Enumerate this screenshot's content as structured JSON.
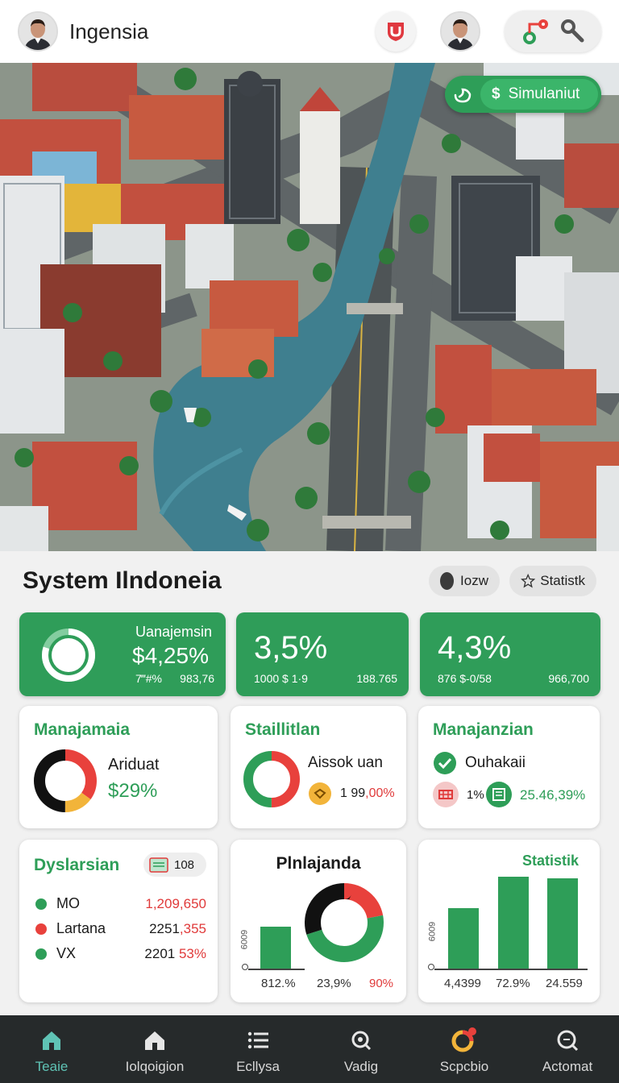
{
  "header": {
    "app_name": "Ingensia"
  },
  "map": {
    "simulate_label": "Simulaniut",
    "simulate_symbol": "$"
  },
  "section": {
    "title": "System Ilndoneia",
    "chip_one": "Iozw",
    "chip_two": "Statistk"
  },
  "stat_cards": [
    {
      "label": "Uanajemsin",
      "value": "$4,25%",
      "sub_left": "7‴#%",
      "sub_right": "983,76",
      "ring_progress": 0.8
    },
    {
      "value": "3,5%",
      "sub_left": "1000 $ 1·9",
      "sub_right": "188.765"
    },
    {
      "value": "4,3%",
      "sub_left": "876 $-0/58",
      "sub_right": "966,700"
    }
  ],
  "cards": {
    "manajamaia": {
      "title": "Manajamaia",
      "label": "Ariduat",
      "value": "$29%",
      "donut": [
        {
          "color": "#e8413c",
          "value": 35
        },
        {
          "color": "#f2b43a",
          "value": 15
        },
        {
          "color": "#111111",
          "value": 50
        }
      ]
    },
    "staillitlan": {
      "title": "Staillitlan",
      "label": "Aissok uan",
      "value_a": "1 99",
      "value_b": ",00%",
      "donut": [
        {
          "color": "#e8413c",
          "value": 50
        },
        {
          "color": "#2e9e58",
          "value": 50
        }
      ]
    },
    "manajanzian": {
      "title": "Manajanzian",
      "label": "Ouhakaii",
      "value_a": "1%",
      "value_b": "25.46,39%"
    },
    "dyslarsian": {
      "title": "Dyslarsian",
      "badge": "108",
      "rows": [
        {
          "color": "#2e9e58",
          "name": "MO",
          "value": "1,209,650",
          "value_color": "#e03a3a"
        },
        {
          "color": "#e8413c",
          "name": "Lartana",
          "value_a": "2251",
          "value_b": ",355"
        },
        {
          "color": "#2e9e58",
          "name": "VX",
          "value_a": "2201",
          "value_b": "53%"
        }
      ]
    },
    "plnlajanda": {
      "title": "Plnlajanda",
      "axis_label": "6009",
      "label_a": "812.%",
      "label_b": "23,9%",
      "label_c": "90%",
      "bar_level": 0.7,
      "donut": [
        {
          "color": "#e8413c",
          "value": 22
        },
        {
          "color": "#2e9e58",
          "value": 48
        },
        {
          "color": "#111111",
          "value": 30
        }
      ]
    },
    "statistik": {
      "title": "Statistik",
      "axis_label": "6009",
      "labels": [
        "4,4399",
        "72.9%",
        "24.559"
      ],
      "bar_levels": [
        0.66,
        1.0,
        0.98
      ]
    }
  },
  "nav": [
    {
      "label": "Teaie",
      "icon": "home-icon",
      "active": true
    },
    {
      "label": "Iolqoigion",
      "icon": "house-icon"
    },
    {
      "label": "Ecllysa",
      "icon": "list-icon"
    },
    {
      "label": "Vadig",
      "icon": "search-icon"
    },
    {
      "label": "Scpcbio",
      "icon": "pie-icon"
    },
    {
      "label": "Actomat",
      "icon": "magnify-icon"
    }
  ],
  "colors": {
    "brand_green": "#2e9e58",
    "accent_red": "#e8413c",
    "nav_bg": "#262a2b",
    "nav_active": "#5fc3b5"
  }
}
